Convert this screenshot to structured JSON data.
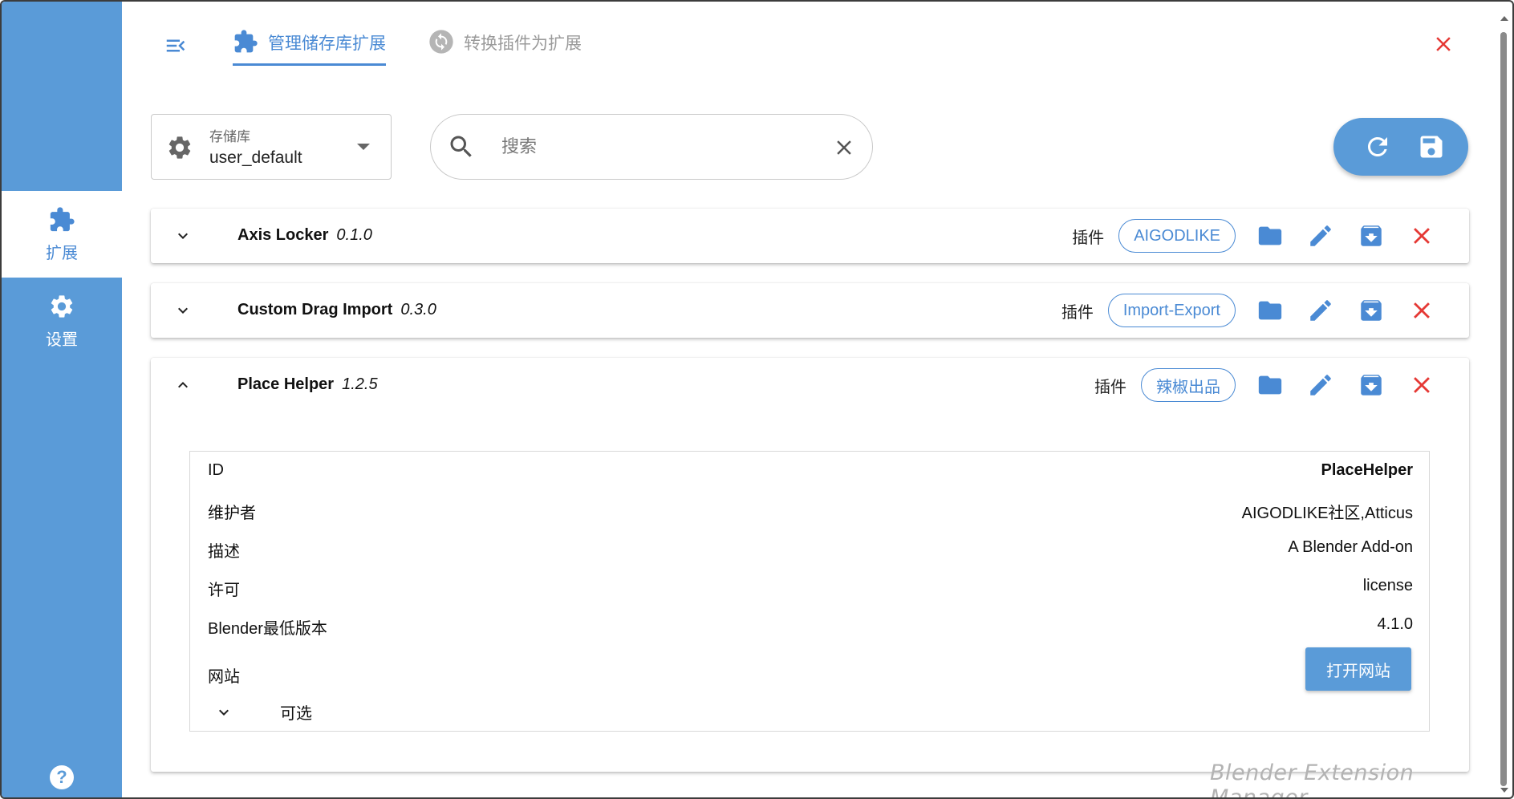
{
  "sidebar": {
    "items": [
      {
        "label": "扩展",
        "icon": "puzzle-icon",
        "active": true
      },
      {
        "label": "设置",
        "icon": "gear-icon",
        "active": false
      }
    ],
    "help": "?"
  },
  "header": {
    "tabs": [
      {
        "label": "管理储存库扩展",
        "icon": "puzzle-icon",
        "active": true
      },
      {
        "label": "转换插件为扩展",
        "icon": "sync-icon",
        "active": false
      }
    ]
  },
  "toolbar": {
    "repo_caption": "存储库",
    "repo_value": "user_default",
    "search_placeholder": "搜索",
    "search_value": ""
  },
  "extensions": [
    {
      "name": "Axis Locker",
      "version": "0.1.0",
      "type": "插件",
      "tag": "AIGODLIKE",
      "expanded": false
    },
    {
      "name": "Custom Drag Import",
      "version": "0.3.0",
      "type": "插件",
      "tag": "Import-Export",
      "expanded": false
    },
    {
      "name": "Place Helper",
      "version": "1.2.5",
      "type": "插件",
      "tag": "辣椒出品",
      "expanded": true
    }
  ],
  "details": {
    "rows": [
      {
        "key": "ID",
        "value": "PlaceHelper"
      },
      {
        "key": "维护者",
        "value": "AIGODLIKE社区,Atticus"
      },
      {
        "key": "描述",
        "value": "A Blender Add-on"
      },
      {
        "key": "许可",
        "value": "license"
      },
      {
        "key": "Blender最低版本",
        "value": "4.1.0"
      },
      {
        "key": "网站",
        "value": ""
      }
    ],
    "open_website": "打开网站",
    "optional": "可选"
  },
  "watermark": "Blender Extension Manager",
  "colors": {
    "accent": "#5a9bd8",
    "danger": "#e53935",
    "text": "#222222"
  }
}
